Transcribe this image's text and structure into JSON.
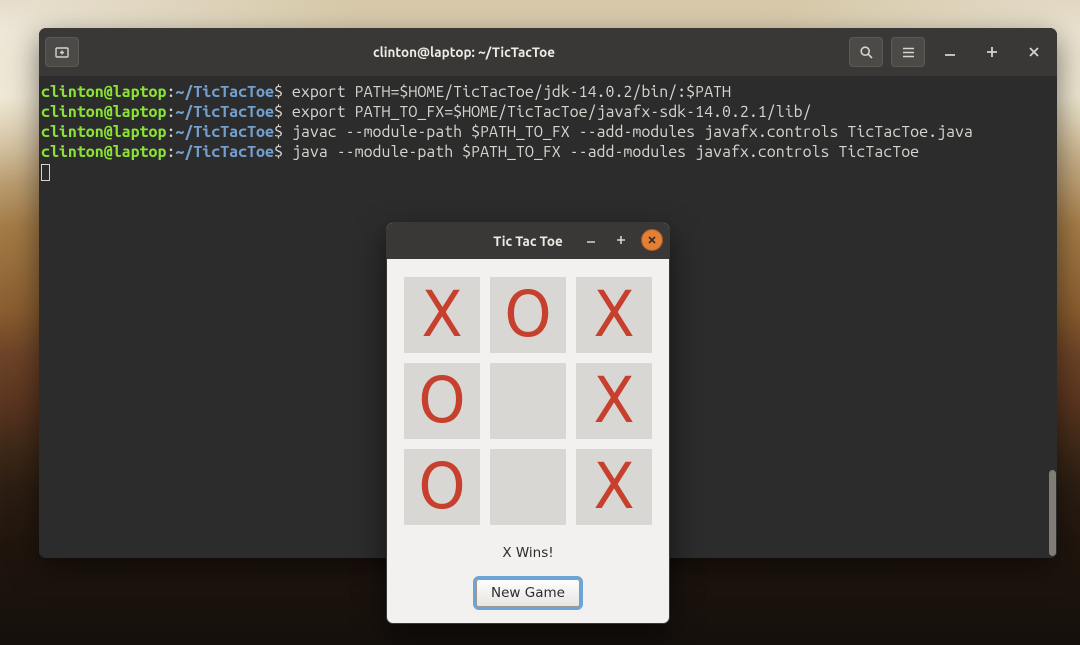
{
  "terminal": {
    "title": "clinton@laptop: ~/TicTacToe",
    "prompt": {
      "user": "clinton@laptop",
      "sep": ":",
      "path": "~/TicTacToe",
      "symbol": "$ "
    },
    "commands": [
      "export PATH=$HOME/TicTacToe/jdk-14.0.2/bin/:$PATH",
      "export PATH_TO_FX=$HOME/TicTacToe/javafx-sdk-14.0.2.1/lib/",
      "javac --module-path $PATH_TO_FX --add-modules javafx.controls TicTacToe.java",
      "java --module-path $PATH_TO_FX --add-modules javafx.controls TicTacToe"
    ],
    "icons": {
      "newtab": "new-tab-icon",
      "search": "search-icon",
      "menu": "hamburger-icon",
      "minimize": "minimize-icon",
      "maximize": "maximize-icon",
      "close": "close-icon"
    }
  },
  "ttt": {
    "title": "Tic Tac Toe",
    "board": [
      "X",
      "O",
      "X",
      "O",
      "",
      "X",
      "O",
      "",
      "X"
    ],
    "status": "X Wins!",
    "new_game_label": "New Game",
    "colors": {
      "mark": "#c7402e",
      "cell": "#d9d7d3"
    }
  }
}
